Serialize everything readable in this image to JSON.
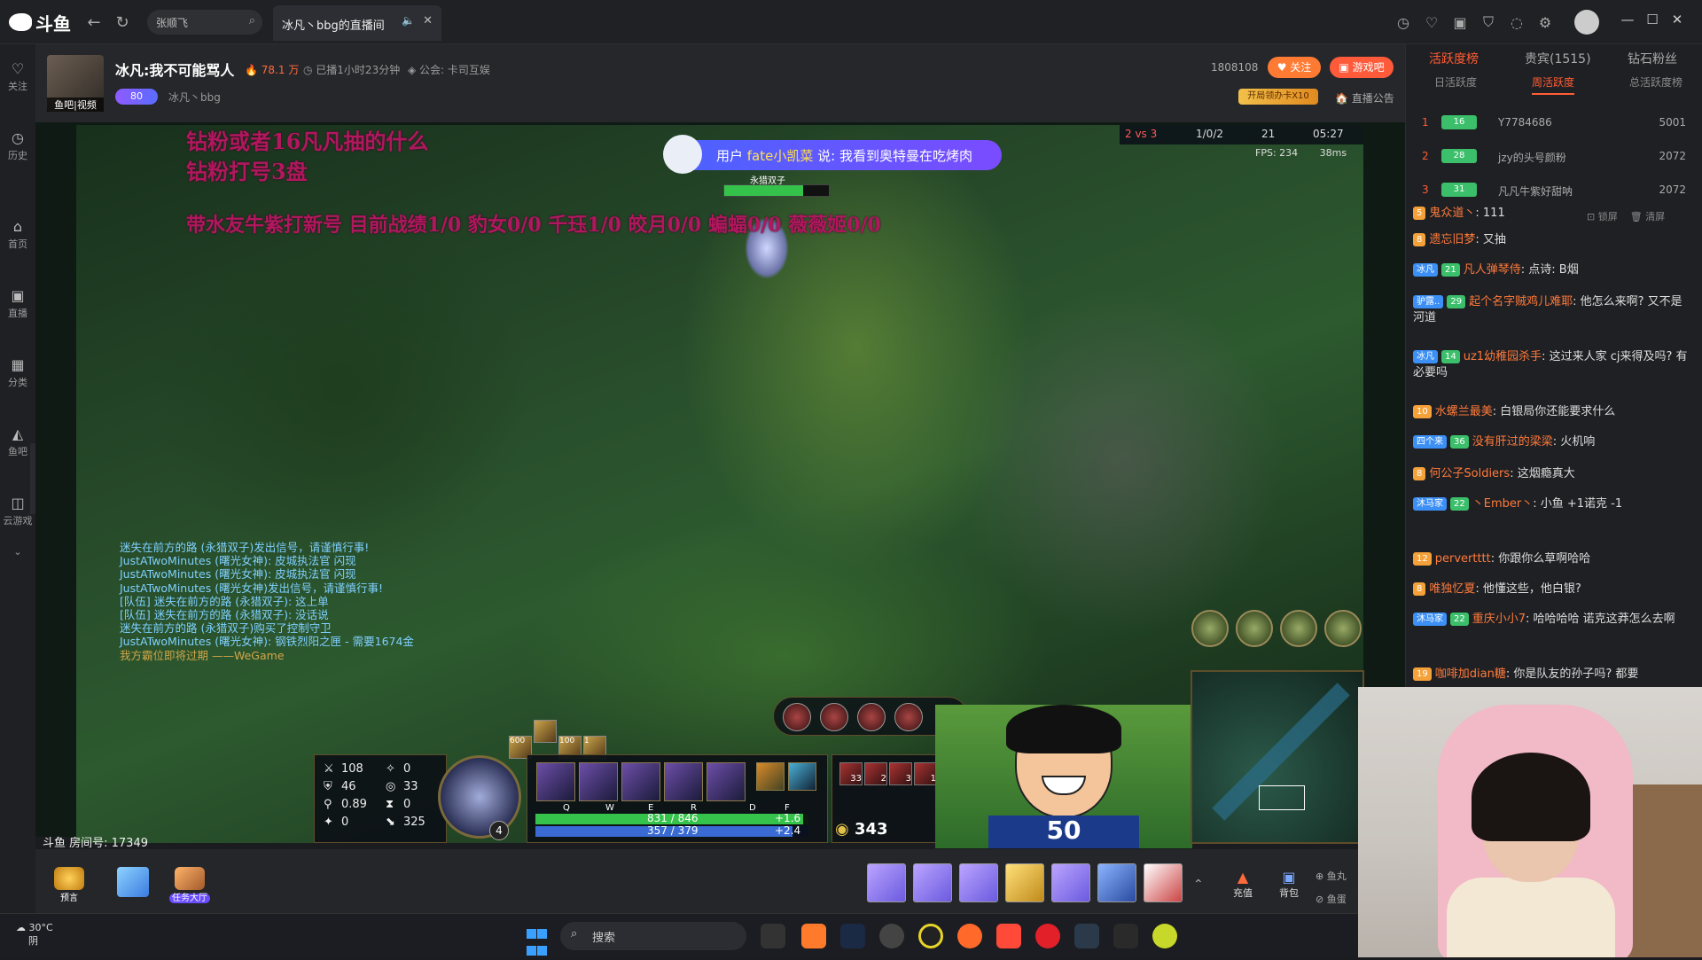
{
  "browser": {
    "logo_text": "斗鱼",
    "search_placeholder": "张顺飞",
    "tab_title": "冰凡丶bbg的直播间"
  },
  "sidebar": {
    "items": [
      "关注",
      "历史",
      "首页",
      "直播",
      "分类",
      "鱼吧",
      "云游戏"
    ]
  },
  "room": {
    "title": "冰凡:我不可能骂人",
    "hot": "78.1 万",
    "live_duration": "已播1小时23分钟",
    "guild": "公会: 卡司互娱",
    "level_badge": "80",
    "anchor_name": "冰凡丶bbg",
    "avatar_tag": "鱼吧|视频",
    "room_number_short": "1808108",
    "follow_label": "关注",
    "gamebar_label": "游戏吧",
    "event_badge": "开局领办卡X10",
    "announce_label": "直播公告",
    "room_id_label": "斗鱼 房间号: 17349"
  },
  "video": {
    "overlay_line1": "钻粉或者16凡凡抽的什么",
    "overlay_line2": "钻粉打号3盘",
    "overlay_line3": "带水友牛紫打新号 目前战绩1/0  豹女0/0 千珏1/0 皎月0/0 蝙蝠0/0 薇薇姬0/0",
    "danmu_prefix": "用户 ",
    "danmu_user": "fate小凯菜",
    "danmu_text": " 说: 我看到奥特曼在吃烤肉",
    "score": "2 vs 3",
    "kda": "1/0/2",
    "cs": "21",
    "time": "05:27",
    "fps": "FPS: 234",
    "ping": "38ms",
    "champion_name": "永猎双子",
    "champion_level": "4"
  },
  "game_chat": [
    {
      "text": "迷失在前方的路 (永猎双子)发出信号，请谨慎行事!",
      "color": "cb"
    },
    {
      "text": "JustATwoMinutes (曙光女神): 皮城执法官 闪现",
      "color": "cb"
    },
    {
      "text": "JustATwoMinutes (曙光女神): 皮城执法官 闪现",
      "color": "cb"
    },
    {
      "text": "JustATwoMinutes (曙光女神)发出信号，请谨慎行事!",
      "color": "cb"
    },
    {
      "text": "[队伍] 迷失在前方的路 (永猎双子): 这上单",
      "color": "cb"
    },
    {
      "text": "[队伍] 迷失在前方的路 (永猎双子): 没话说",
      "color": "cb"
    },
    {
      "text": "迷失在前方的路 (永猎双子)购买了控制守卫",
      "color": "cb"
    },
    {
      "text": "JustATwoMinutes (曙光女神): 钢铁烈阳之匣 - 需要1674金",
      "color": "cb"
    },
    {
      "text": "我方霸位即将过期 ——WeGame",
      "color": "cy"
    }
  ],
  "hud": {
    "ad": "108",
    "armor": "46",
    "attack_speed": "0.89",
    "crit": "0",
    "ap": "0",
    "mr": "33",
    "ah": "0",
    "move_speed": "325",
    "portrait_level": "4",
    "hp": "831 / 846",
    "hp_regen": "+1.6",
    "mana": "357 / 379",
    "mana_regen": "+2.4",
    "gold": "343",
    "skill_keys": [
      "Q",
      "W",
      "E",
      "R",
      "D",
      "F"
    ],
    "buff_values": [
      "600",
      "",
      "100",
      "1"
    ],
    "item_counts": [
      "33",
      "2",
      "3",
      "1"
    ]
  },
  "luffy_shirt": "50",
  "bottom": {
    "predict_label": "预言",
    "gift_label": "",
    "task_label": "任务大厅",
    "recharge_label": "充值",
    "backpack_label": "背包",
    "fishball_label": "鱼丸",
    "fishegg_label": "鱼蛋"
  },
  "right_panel": {
    "tabs": [
      "活跃度榜",
      "贵宾(1515)",
      "钻石粉丝"
    ],
    "subtabs": [
      "日活跃度",
      "周活跃度",
      "总活跃度榜"
    ],
    "rank": [
      {
        "num": "1",
        "lv": "16",
        "name": "Y7784686",
        "score": "5001"
      },
      {
        "num": "2",
        "lv": "28",
        "name": "jzy的头号颜粉",
        "score": "2072"
      },
      {
        "num": "3",
        "lv": "31",
        "name": "凡凡牛紫好甜呐",
        "score": "2072"
      }
    ],
    "chat_tools": [
      "锁屏",
      "清屏"
    ],
    "messages": [
      {
        "badge": "5",
        "name": "鬼众道丶",
        "text": ": 111"
      },
      {
        "badge": "8",
        "name": "遗忘旧梦",
        "text": ": 又抽"
      },
      {
        "badge": "冰凡",
        "badge2": "21",
        "name": "凡人弹琴侍",
        "text": ": 点诗: B烟"
      },
      {
        "badge": "驴露..",
        "badge2": "29",
        "name": "起个名字贼鸡儿难耶",
        "text": ": 他怎么来啊? 又不是河道"
      },
      {
        "badge": "冰凡",
        "badge2": "14",
        "name": "uz1幼稚园杀手",
        "text": ": 这过来人家 cj来得及吗? 有必要吗"
      },
      {
        "badge": "10",
        "name": "水螺兰最美",
        "text": ": 白银局你还能要求什么"
      },
      {
        "badge": "四个来",
        "badge2": "36",
        "name": "没有肝过的梁梁",
        "text": ": 火机响"
      },
      {
        "badge": "8",
        "name": "何公子Soldiers",
        "text": ": 这烟瘾真大"
      },
      {
        "badge": "沐马家",
        "badge2": "22",
        "name": "丶Ember丶",
        "text": ": 小鱼 +1诺克 -1"
      },
      {
        "badge": "12",
        "name": "pervertttt",
        "text": ": 你跟你么草啊哈哈"
      },
      {
        "badge": "8",
        "name": "唯独忆夏",
        "text": ": 他懂这些，他白银?"
      },
      {
        "badge": "沐马家",
        "badge2": "22",
        "name": "重庆小小7",
        "text": ": 哈哈哈哈 诺克这莽怎么去啊"
      },
      {
        "badge": "19",
        "name": "咖啡加dian糖",
        "text": ": 你是队友的孙子吗? 都要"
      }
    ]
  },
  "taskbar": {
    "temp": "30°C",
    "weather": "阴",
    "search_label": "搜索"
  },
  "colors": {
    "accent": "#ff5d34",
    "overlay_text": "#b0185e",
    "danmu_bg": "#5a5cff"
  }
}
